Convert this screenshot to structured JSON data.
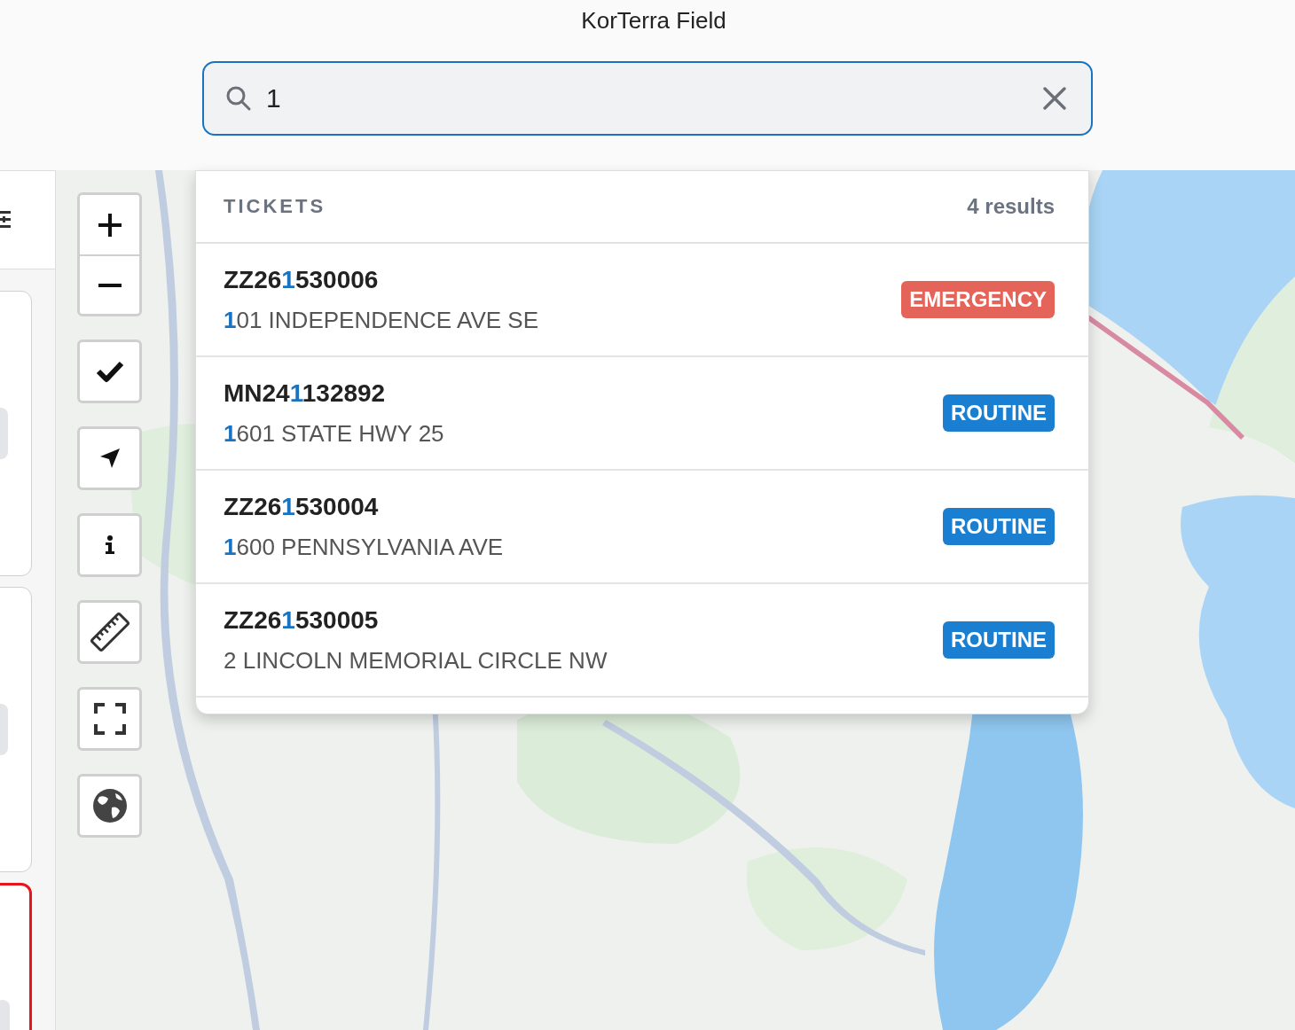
{
  "app": {
    "title": "KorTerra Field"
  },
  "search": {
    "value": "1"
  },
  "side_panel": {
    "cards": [
      {
        "selected": false
      },
      {
        "selected": false
      },
      {
        "selected": true
      }
    ]
  },
  "results": {
    "section": "TICKETS",
    "count": "4 results",
    "items": [
      {
        "number": [
          {
            "text": "ZZ26",
            "match": false
          },
          {
            "text": "1",
            "match": true
          },
          {
            "text": "530006",
            "match": false
          }
        ],
        "address": [
          {
            "text": "1",
            "match": true
          },
          {
            "text": "01 INDEPENDENCE AVE SE",
            "match": false
          }
        ],
        "priority": {
          "kind": "emergency",
          "label": "EMERGENCY"
        }
      },
      {
        "number": [
          {
            "text": "MN24",
            "match": false
          },
          {
            "text": "1",
            "match": true
          },
          {
            "text": "132892",
            "match": false
          }
        ],
        "address": [
          {
            "text": "1",
            "match": true
          },
          {
            "text": "601 STATE HWY 25",
            "match": false
          }
        ],
        "priority": {
          "kind": "routine",
          "label": "ROUTINE"
        }
      },
      {
        "number": [
          {
            "text": "ZZ26",
            "match": false
          },
          {
            "text": "1",
            "match": true
          },
          {
            "text": "530004",
            "match": false
          }
        ],
        "address": [
          {
            "text": "1",
            "match": true
          },
          {
            "text": "600 PENNSYLVANIA AVE",
            "match": false
          }
        ],
        "priority": {
          "kind": "routine",
          "label": "ROUTINE"
        }
      },
      {
        "number": [
          {
            "text": "ZZ26",
            "match": false
          },
          {
            "text": "1",
            "match": true
          },
          {
            "text": "530005",
            "match": false
          }
        ],
        "address": [
          {
            "text": "2 LINCOLN MEMORIAL CIRCLE NW",
            "match": false
          }
        ],
        "priority": {
          "kind": "routine",
          "label": "ROUTINE"
        }
      }
    ]
  }
}
